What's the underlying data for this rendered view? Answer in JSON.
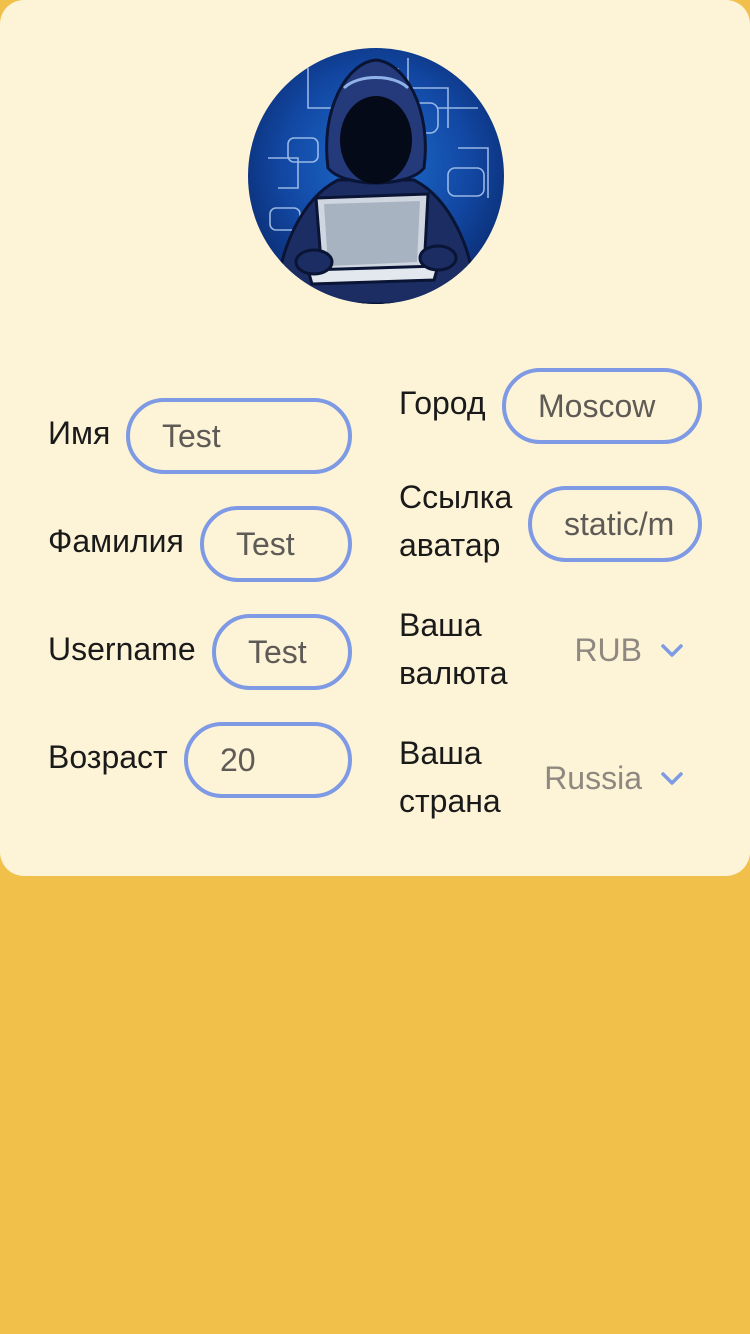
{
  "profile": {
    "avatar_icon": "hooded-hacker-laptop-avatar"
  },
  "form_left": {
    "first_name": {
      "label": "Имя",
      "value": "Test"
    },
    "last_name": {
      "label": "Фамилия",
      "value": "Test"
    },
    "username": {
      "label": "Username",
      "value": "Test"
    },
    "age": {
      "label": "Возраст",
      "value": "20"
    }
  },
  "form_right": {
    "city": {
      "label": "Город",
      "value": "Moscow"
    },
    "avatar_link": {
      "label_line1": "Ссылка",
      "label_line2": "аватар",
      "value": "static/m"
    },
    "currency": {
      "label_line1": "Ваша",
      "label_line2": "валюта",
      "value": "RUB"
    },
    "country": {
      "label_line1": "Ваша",
      "label_line2": "страна",
      "value": "Russia"
    }
  },
  "colors": {
    "page_background": "#f0c04b",
    "card_background": "#fdf3d7",
    "input_border": "#7f9ae4",
    "chevron": "#7f9ae4"
  }
}
